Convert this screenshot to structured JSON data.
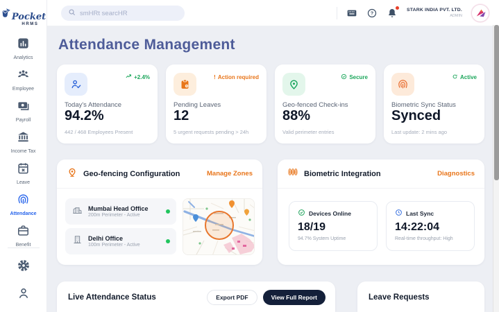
{
  "brand": {
    "name": "Pocket",
    "sub": "HRMS"
  },
  "header": {
    "search_placeholder": "smHRt searcHR",
    "company_name": "STARK INDIA PVT. LTD.",
    "company_role": "ADMIN"
  },
  "sidebar": {
    "items": [
      {
        "label": "Analytics",
        "icon": "bar-chart-icon",
        "active": false
      },
      {
        "label": "Employee",
        "icon": "people-icon",
        "active": false
      },
      {
        "label": "Payroll",
        "icon": "payroll-card-icon",
        "active": false
      },
      {
        "label": "Income Tax",
        "icon": "bank-icon",
        "active": false
      },
      {
        "label": "Leave",
        "icon": "calendar-x-icon",
        "active": false
      },
      {
        "label": "Attendance",
        "icon": "fingerprint-icon",
        "active": true
      },
      {
        "label": "Benefit",
        "icon": "briefcase-icon",
        "active": false
      }
    ]
  },
  "page": {
    "title": "Attendance Management"
  },
  "stats": [
    {
      "title": "Today's Attendance",
      "value": "94.2%",
      "subtext": "442 / 468 Employees Present",
      "badge": "+2.4%",
      "badge_icon": "trend-up-icon",
      "badge_color": "#1ca65b",
      "icon": "user-check-icon",
      "icon_color": "#2b63d9",
      "icon_bg": "#e5edfc"
    },
    {
      "title": "Pending Leaves",
      "value": "12",
      "subtext": "5 urgent requests pending > 24h",
      "badge": "Action required",
      "badge_icon": "alert-icon",
      "badge_color": "#e8751a",
      "icon": "clipboard-icon",
      "icon_color": "#e8761a",
      "icon_bg": "#fdeedd"
    },
    {
      "title": "Geo-fenced Check-ins",
      "value": "88%",
      "subtext": "Valid perimeter entries",
      "badge": "Secure",
      "badge_icon": "check-circle-icon",
      "badge_color": "#1ca65b",
      "icon": "map-pin-icon",
      "icon_color": "#17a45c",
      "icon_bg": "#e3f6eb"
    },
    {
      "title": "Biometric Sync Status",
      "value": "Synced",
      "subtext": "Last update: 2 mins ago",
      "badge": "Active",
      "badge_icon": "refresh-icon",
      "badge_color": "#1ca65b",
      "icon": "fingerprint-icon",
      "icon_color": "#e8692a",
      "icon_bg": "#fdeada"
    }
  ],
  "geofencing": {
    "title": "Geo-fencing Configuration",
    "action": "Manage Zones",
    "zones": [
      {
        "name": "Mumbai Head Office",
        "detail": "200m Perimeter - Active",
        "status_color": "#22c55e"
      },
      {
        "name": "Delhi Office",
        "detail": "100m Perimeter - Active",
        "status_color": "#22c55e"
      }
    ],
    "geofence_circle_color": "#e8762c"
  },
  "biometric": {
    "title": "Biometric Integration",
    "action": "Diagnostics",
    "metrics": [
      {
        "label": "Devices Online",
        "value": "18/19",
        "subtext": "94.7% System Uptime",
        "icon": "check-circle-icon"
      },
      {
        "label": "Last Sync",
        "value": "14:22:04",
        "subtext": "Real-time throughput: High",
        "icon": "clock-icon"
      }
    ]
  },
  "live_attendance": {
    "title": "Live Attendance Status",
    "export_label": "Export PDF",
    "report_label": "View Full Report"
  },
  "leave_requests": {
    "title": "Leave Requests"
  },
  "colors": {
    "accent_orange": "#e8751a",
    "accent_blue": "#2563eb",
    "success_green": "#1ca65b",
    "title_indigo": "#4e5c99",
    "dark_navy": "#14203a",
    "page_bg": "#edeff4"
  }
}
